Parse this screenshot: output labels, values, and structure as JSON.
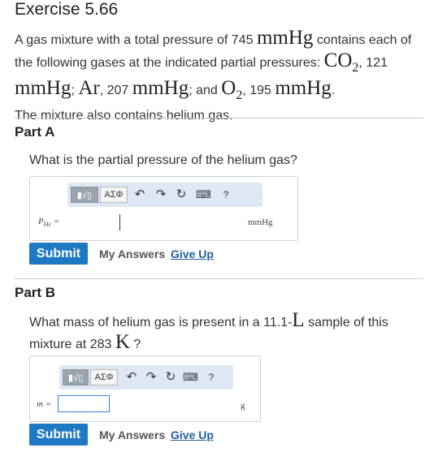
{
  "exercise": {
    "title": "Exercise 5.66"
  },
  "problem": {
    "t1": "A gas mixture with a total pressure of 745 ",
    "u1": "mmHg",
    "t2": " contains each of the following gases at the indicated partial pressures: ",
    "co2": "CO",
    "co2_sub": "2",
    "t3": ", 121 ",
    "u2": "mmHg",
    "t4": "; ",
    "ar": "Ar",
    "t5": ", 207 ",
    "u3": "mmHg",
    "t6": "; and ",
    "o2": "O",
    "o2_sub": "2",
    "t7": ", 195 ",
    "u4": "mmHg",
    "t8": ".",
    "t9": "The mixture also contains helium gas."
  },
  "toolbar": {
    "template_label": "▮√▯",
    "symbols_label": "ΑΣΦ",
    "undo_icon": "↶",
    "redo_icon": "↷",
    "reset_icon": "↻",
    "keyboard_icon": "⌨",
    "help_label": "?"
  },
  "part_a": {
    "title": "Part A",
    "question": "What is the partial pressure of the helium gas?",
    "var_main": "P",
    "var_sub": "He",
    "var_eq": " =",
    "unit": "mmHg",
    "input_value": "",
    "submit_label": "Submit",
    "my_answers_label": "My Answers",
    "give_up_label": "Give Up"
  },
  "part_b": {
    "title": "Part B",
    "q1": "What mass of helium gas is present in a 11.1-",
    "q_unit_l": "L",
    "q2": " sample of this mixture at 283 ",
    "q_unit_k": "K",
    "q3": " ?",
    "var_label": "m =",
    "unit": "g",
    "input_value": "",
    "submit_label": "Submit",
    "my_answers_label": "My Answers",
    "give_up_label": "Give Up"
  }
}
